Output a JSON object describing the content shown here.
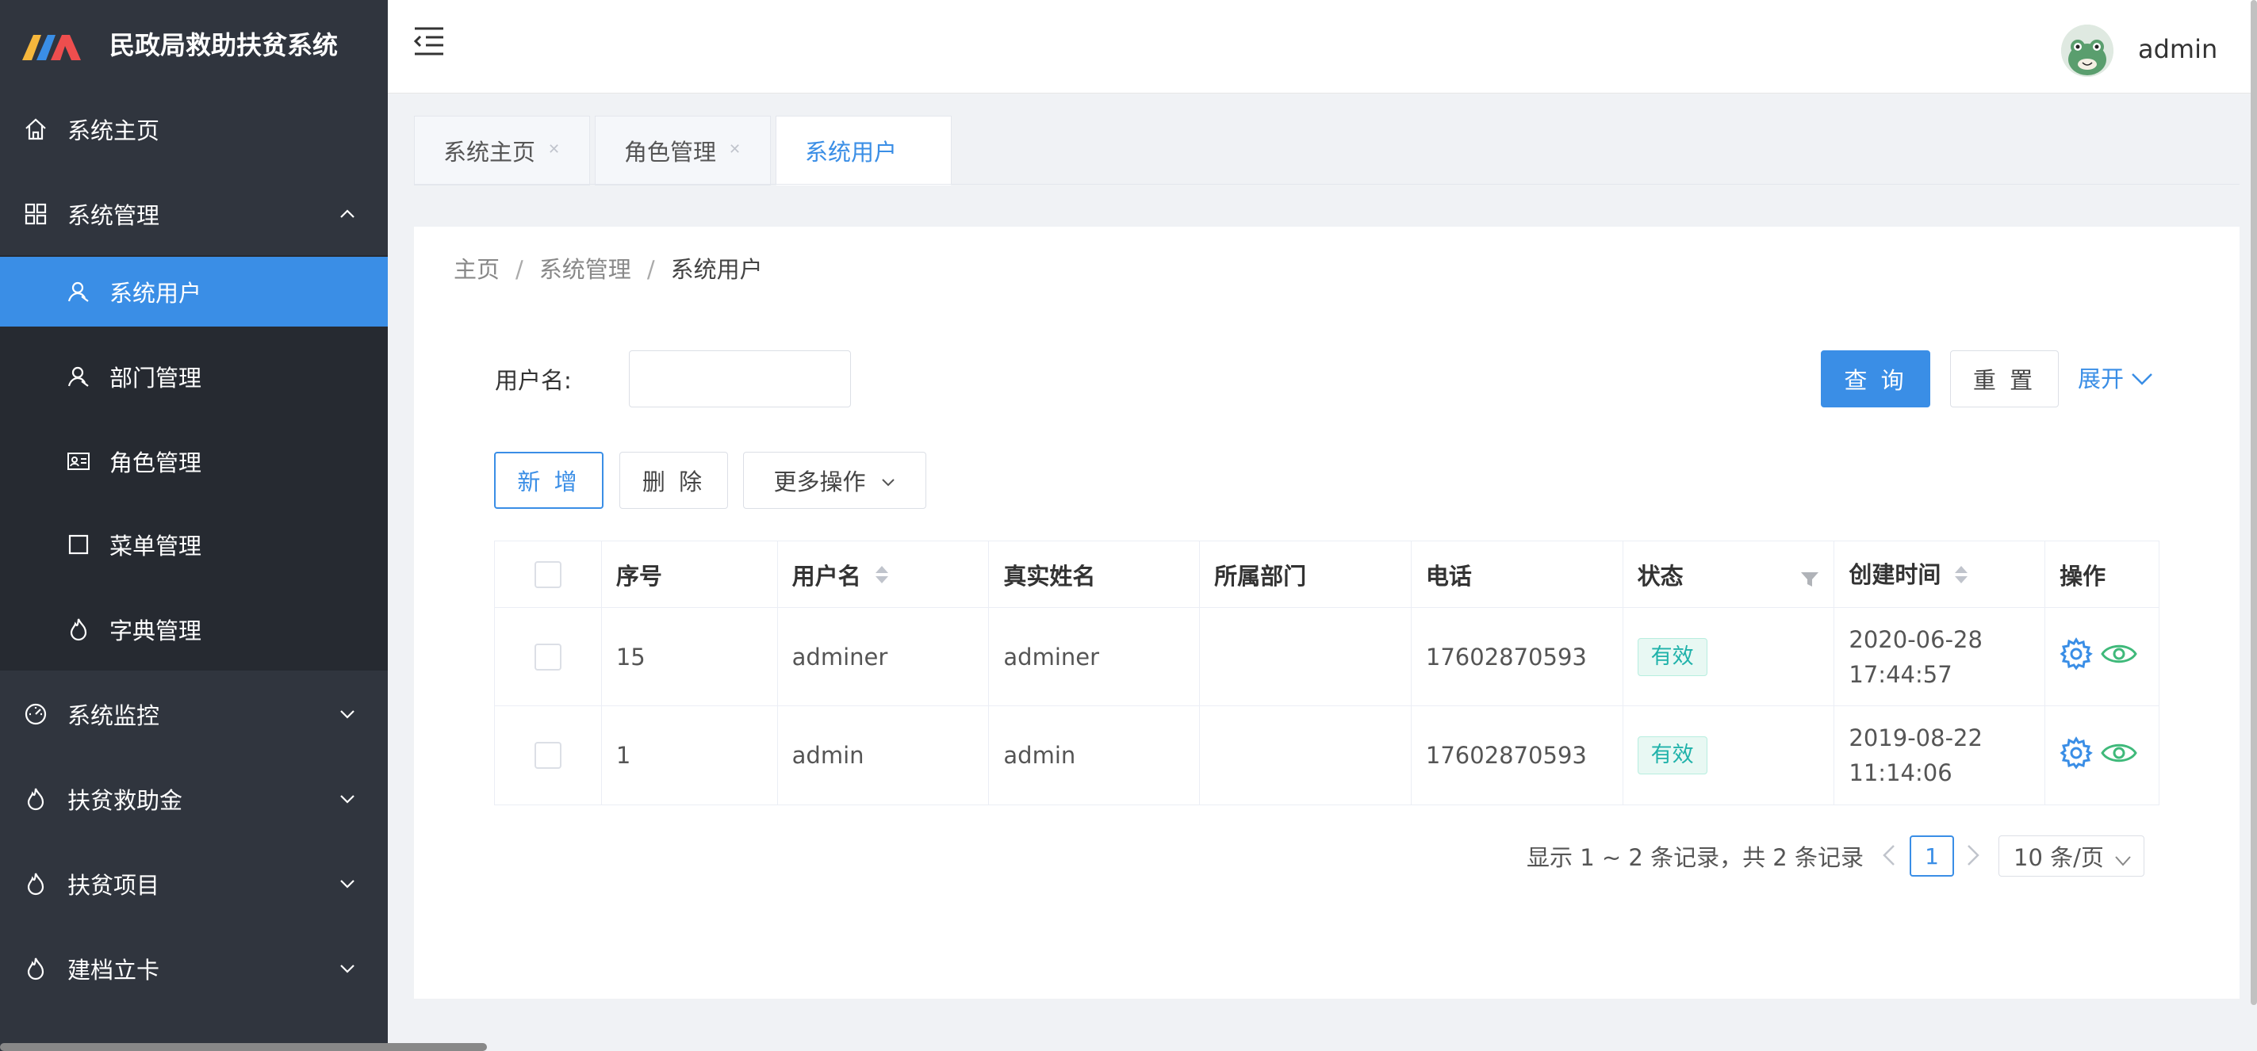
{
  "app": {
    "title": "民政局救助扶贫系统"
  },
  "sidebar": {
    "items": [
      {
        "label": "系统主页",
        "icon": "home-icon"
      },
      {
        "label": "系统管理",
        "icon": "grid-icon",
        "expanded": true
      },
      {
        "label": "系统用户",
        "icon": "user-icon",
        "active": true
      },
      {
        "label": "部门管理",
        "icon": "user-icon"
      },
      {
        "label": "角色管理",
        "icon": "id-card-icon"
      },
      {
        "label": "菜单管理",
        "icon": "square-icon"
      },
      {
        "label": "字典管理",
        "icon": "fire-icon"
      },
      {
        "label": "系统监控",
        "icon": "dashboard-icon"
      },
      {
        "label": "扶贫救助金",
        "icon": "fire-icon"
      },
      {
        "label": "扶贫项目",
        "icon": "fire-icon"
      },
      {
        "label": "建档立卡",
        "icon": "fire-icon"
      }
    ]
  },
  "header": {
    "username": "admin"
  },
  "tabs": [
    {
      "label": "系统主页"
    },
    {
      "label": "角色管理"
    },
    {
      "label": "系统用户",
      "active": true
    }
  ],
  "breadcrumb": {
    "home": "主页",
    "parent": "系统管理",
    "current": "系统用户",
    "sep": "/"
  },
  "search": {
    "label": "用户名:",
    "value": "",
    "placeholder": ""
  },
  "buttons": {
    "query": "查 询",
    "reset": "重 置",
    "expand": "展开",
    "add": "新 增",
    "delete": "删 除",
    "more": "更多操作"
  },
  "table": {
    "columns": [
      "序号",
      "用户名",
      "真实姓名",
      "所属部门",
      "电话",
      "状态",
      "创建时间",
      "操作"
    ],
    "rows": [
      {
        "id": "15",
        "username": "adminer",
        "realname": "adminer",
        "dept": "",
        "phone": "17602870593",
        "status": "有效",
        "created_date": "2020-06-28",
        "created_time": "17:44:57"
      },
      {
        "id": "1",
        "username": "admin",
        "realname": "admin",
        "dept": "",
        "phone": "17602870593",
        "status": "有效",
        "created_date": "2019-08-22",
        "created_time": "11:14:06"
      }
    ]
  },
  "pagination": {
    "summary": "显示 1 ~ 2 条记录，共 2 条记录",
    "current_page": "1",
    "page_size": "10 条/页"
  },
  "colors": {
    "accent": "#3a8ee6",
    "sidebar_bg": "#30353e",
    "submenu_bg": "#262a31",
    "status_tag": "#20b2aa"
  }
}
